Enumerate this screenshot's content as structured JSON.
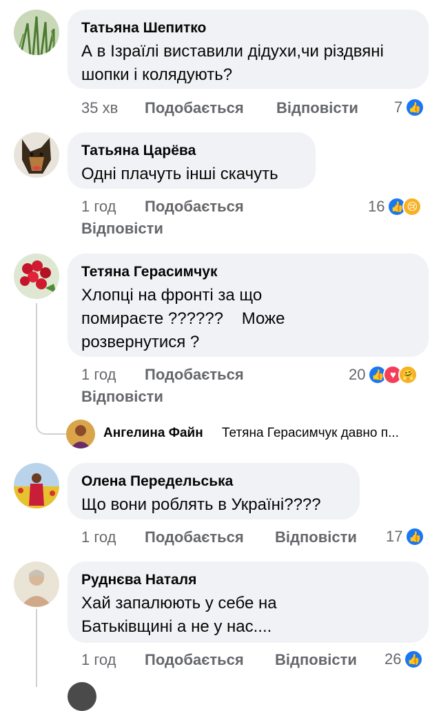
{
  "colors": {
    "like": "#1877f2",
    "love": "#f33e58",
    "care": "#f7b125",
    "meta_text": "#65676b",
    "bubble": "#f0f2f5"
  },
  "comments": [
    {
      "author": "Татьяна Шепитко",
      "text": "А в Ізраїлі виставили дідухи,чи різдвяні шопки і колядують?",
      "time": "35 хв",
      "like_label": "Подобається",
      "reply_label": "Відповісти",
      "reaction_count": "7",
      "reactions": [
        "like-icon"
      ]
    },
    {
      "author": "Татьяна Царёва",
      "text": "Одні плачуть інші скачуть",
      "time": "1 год",
      "like_label": "Подобається",
      "reply_label": "Відповісти",
      "reaction_count": "16",
      "reactions": [
        "like-icon",
        "sad-icon"
      ]
    },
    {
      "author": "Тетяна Герасимчук",
      "text": "Хлопці на фронті за що помираєте ??????    Може розвернутися ?",
      "time": "1 год",
      "like_label": "Подобається",
      "reply_label": "Відповісти",
      "reaction_count": "20",
      "reactions": [
        "like-icon",
        "love-icon",
        "care-icon"
      ]
    },
    {
      "author": "Олена Передельська",
      "text": "Що вони роблять в Україні????",
      "time": "1 год",
      "like_label": "Подобається",
      "reply_label": "Відповісти",
      "reaction_count": "17",
      "reactions": [
        "like-icon"
      ]
    },
    {
      "author": "Руднєва Наталя",
      "text": "Хай запалюють у себе на Батьківщині а не у нас....",
      "time": "1 год",
      "like_label": "Подобається",
      "reply_label": "Відповісти",
      "reaction_count": "26",
      "reactions": [
        "like-icon"
      ]
    }
  ],
  "reply": {
    "author": "Ангелина Файн",
    "text": "Тетяна Герасимчук давно п..."
  }
}
